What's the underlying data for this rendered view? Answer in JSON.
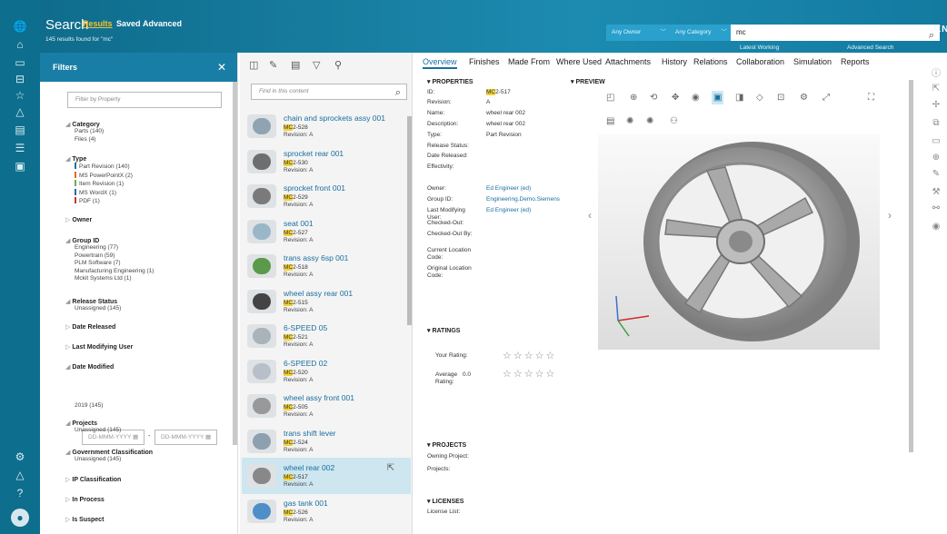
{
  "rail": {
    "icons": [
      "globe-icon",
      "home-icon",
      "folder-icon",
      "inbox-icon",
      "star-icon",
      "alert-icon",
      "report-icon",
      "list-icon",
      "image-icon",
      "settings-icon",
      "user-icon",
      "help-icon",
      "avatar"
    ]
  },
  "header": {
    "title": "Search",
    "tabs": [
      "Results",
      "Saved",
      "Advanced"
    ],
    "found": "145 results found for \"mc\"",
    "owner": "Any Owner",
    "category": "Any Category",
    "query": "mc",
    "latest": "Latest Working",
    "advanced": "Advanced Search",
    "brand": "SIEMENS"
  },
  "filters": {
    "title": "Filters",
    "close": "✕",
    "placeholder": "Filter by Property",
    "category": {
      "label": "Category",
      "items": [
        "Parts (140)",
        "Files (4)"
      ]
    },
    "type": {
      "label": "Type",
      "items": [
        {
          "t": "Part Revision (140)",
          "c": "#2a6aa8"
        },
        {
          "t": "MS PowerPointX (2)",
          "c": "#e0692a"
        },
        {
          "t": "Item Revision (1)",
          "c": "#6ab04c"
        },
        {
          "t": "MS WordX (1)",
          "c": "#2a6aa8"
        },
        {
          "t": "PDF (1)",
          "c": "#c0392b"
        }
      ]
    },
    "owner": "Owner",
    "group": {
      "label": "Group ID",
      "items": [
        "Engineering (77)",
        "Powertrain (59)",
        "PLM Software (7)",
        "Manufacturing Engineering (1)",
        "Mckit Systems Ltd (1)"
      ]
    },
    "release": {
      "label": "Release Status",
      "items": [
        "Unassigned (145)"
      ]
    },
    "date_released": "Date Released",
    "last_mod": "Last Modifying User",
    "date_mod": {
      "label": "Date Modified",
      "from": "DD-MMM-YYYY",
      "to": "DD-MMM-YYYY",
      "year": "2019 (145)"
    },
    "projects": {
      "label": "Projects",
      "items": [
        "Unassigned (145)"
      ]
    },
    "gov": {
      "label": "Government Classification",
      "items": [
        "Unassigned (145)"
      ]
    },
    "ip": "IP Classification",
    "inproc": "In Process",
    "suspect": "Is Suspect"
  },
  "list": {
    "find": "Find in this content",
    "items": [
      {
        "name": "chain and sprockets assy 001",
        "id_hl": "MC",
        "id": "2-528",
        "rev": "Revision: A"
      },
      {
        "name": "sprocket rear 001",
        "id_hl": "MC",
        "id": "2-530",
        "rev": "Revision: A"
      },
      {
        "name": "sprocket front 001",
        "id_hl": "MC",
        "id": "2-529",
        "rev": "Revision: A"
      },
      {
        "name": "seat 001",
        "id_hl": "MC",
        "id": "2-527",
        "rev": "Revision: A"
      },
      {
        "name": "trans assy 6sp 001",
        "id_hl": "MC",
        "id": "2-518",
        "rev": "Revision: A"
      },
      {
        "name": "wheel assy rear 001",
        "id_hl": "MC",
        "id": "2-515",
        "rev": "Revision: A"
      },
      {
        "name": "6-SPEED 05",
        "id_hl": "MC",
        "id": "2-521",
        "rev": "Revision: A"
      },
      {
        "name": "6-SPEED 02",
        "id_hl": "MC",
        "id": "2-520",
        "rev": "Revision: A"
      },
      {
        "name": "wheel assy front 001",
        "id_hl": "MC",
        "id": "2-505",
        "rev": "Revision: A"
      },
      {
        "name": "trans shift lever",
        "id_hl": "MC",
        "id": "2-524",
        "rev": "Revision: A"
      },
      {
        "name": "wheel rear 002",
        "id_hl": "MC",
        "id": "2-517",
        "rev": "Revision: A"
      },
      {
        "name": "gas tank 001",
        "id_hl": "MC",
        "id": "2-526",
        "rev": "Revision: A"
      }
    ]
  },
  "detail": {
    "tabs": [
      "Overview",
      "Finishes",
      "Made From",
      "Where Used",
      "Attachments",
      "History",
      "Relations",
      "Collaboration",
      "Simulation",
      "Reports"
    ],
    "properties": "PROPERTIES",
    "preview": "PREVIEW",
    "props": [
      {
        "l": "ID:",
        "v": "2-517",
        "hl": "MC"
      },
      {
        "l": "Revision:",
        "v": "A"
      },
      {
        "l": "Name:",
        "v": "wheel rear 002"
      },
      {
        "l": "Description:",
        "v": "wheel rear 002"
      },
      {
        "l": "Type:",
        "v": "Part Revision"
      },
      {
        "l": "Release Status:",
        "v": ""
      },
      {
        "l": "Date Released:",
        "v": ""
      },
      {
        "l": "Effectivity:",
        "v": ""
      },
      {
        "l": "Owner:",
        "v": "Ed Engineer (ed)",
        "link": true
      },
      {
        "l": "Group ID:",
        "v": "Engineering.Demo.Siemens",
        "link": true
      },
      {
        "l": "Last Modifying User:",
        "v": "Ed Engineer (ed)",
        "link": true
      },
      {
        "l": "Checked-Out:",
        "v": ""
      },
      {
        "l": "Checked-Out By:",
        "v": ""
      },
      {
        "l": "Current Location Code:",
        "v": ""
      },
      {
        "l": "Original Location Code:",
        "v": ""
      }
    ],
    "ratings": "RATINGS",
    "your_rating": "Your Rating:",
    "avg_rating": "Average Rating:",
    "avg_value": "0.0",
    "stars": "☆☆☆☆☆",
    "projects": "PROJECTS",
    "owning": "Owning Project:",
    "projects_l": "Projects:",
    "licenses": "LICENSES",
    "license_list": "License List:"
  }
}
